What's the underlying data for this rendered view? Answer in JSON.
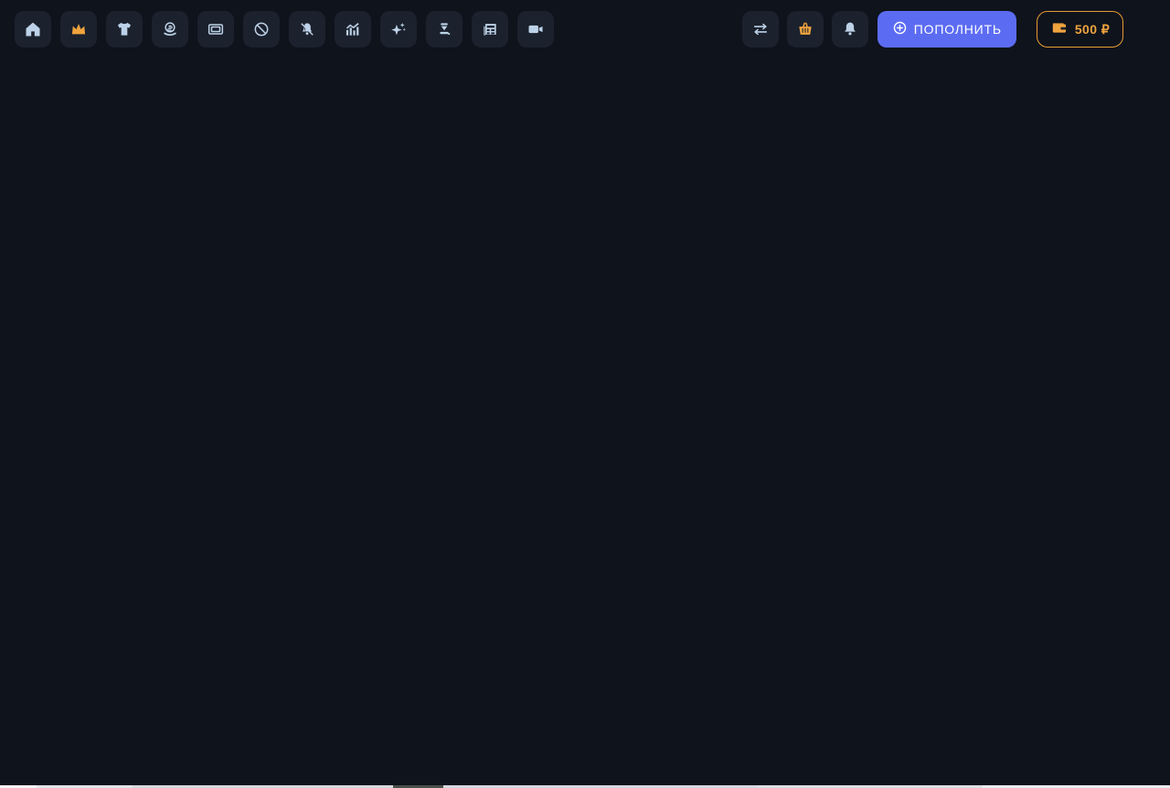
{
  "topbar": {
    "nav_icons": [
      "home-icon",
      "crown-icon",
      "shirt-icon",
      "coin-stand-icon",
      "frame-icon",
      "ban-icon",
      "bell-slash-icon",
      "chart-icon",
      "sparkles-icon",
      "hourglass-icon",
      "newspaper-icon",
      "video-camera-icon"
    ],
    "action_icons": [
      "transfer-arrows-icon",
      "basket-icon",
      "bell-icon"
    ],
    "topup_label": "ПОПОЛНИТЬ",
    "topup_icon": "plus-circle-icon",
    "balance_label": "500 ₽",
    "balance_icon": "wallet-icon"
  },
  "colors": {
    "background": "#0e131c",
    "button_background": "#1b212d",
    "icon": "#bdd2e8",
    "accent_amber": "#f0a43e",
    "accent_blue": "#5c6cf2",
    "balance_border": "#e89c35"
  }
}
